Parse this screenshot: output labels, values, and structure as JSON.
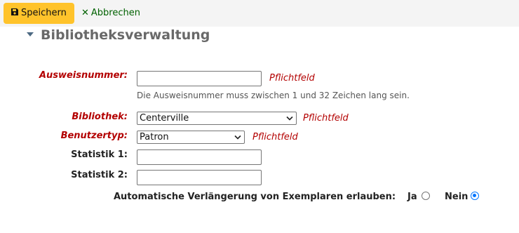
{
  "toolbar": {
    "save_label": "Speichern",
    "save_icon": "save-icon",
    "cancel_label": "Abbrechen",
    "cancel_icon": "close-icon",
    "cancel_color": "#006100",
    "save_color": "#ffc32b"
  },
  "section": {
    "title": "Bibliotheksverwaltung"
  },
  "fields": {
    "cardnumber": {
      "label": "Ausweisnummer:",
      "required_note": "Pflichtfeld",
      "value": "",
      "hint": "Die Ausweisnummer muss zwischen 1 und 32 Zeichen lang sein."
    },
    "library": {
      "label": "Bibliothek:",
      "required_note": "Pflichtfeld",
      "selected": "Centerville"
    },
    "category": {
      "label": "Benutzertyp:",
      "required_note": "Pflichtfeld",
      "selected": "Patron"
    },
    "stat1": {
      "label": "Statistik 1:",
      "value": ""
    },
    "stat2": {
      "label": "Statistik 2:",
      "value": ""
    },
    "autorenew": {
      "label": "Automatische Verlängerung von Exemplaren erlauben:",
      "yes_label": "Ja",
      "no_label": "Nein",
      "selected": "Nein"
    }
  },
  "colors": {
    "required": "#b30000",
    "radio_checked": "#0075ff"
  }
}
